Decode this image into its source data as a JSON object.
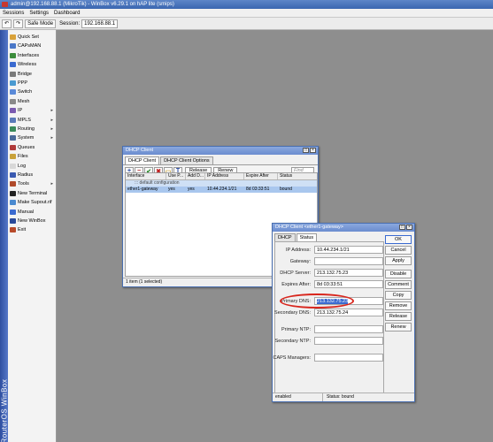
{
  "window": {
    "title": "admin@192.168.88.1 (MikroTik) - WinBox v6.29.1 on hAP lite (smips)"
  },
  "menu": [
    "Sessions",
    "Settings",
    "Dashboard"
  ],
  "toolbar": {
    "undo": "↶",
    "redo": "↷",
    "safe_mode": "Safe Mode",
    "session_label": "Session:",
    "session_value": "192.168.88.1"
  },
  "sidebar": {
    "brand": "RouterOS WinBox",
    "items": [
      {
        "label": "Quick Set",
        "icon": "quick-set-icon",
        "color": "#d9a23a",
        "arrow": ""
      },
      {
        "label": "CAPsMAN",
        "icon": "capsman-icon",
        "color": "#4a78c8",
        "arrow": ""
      },
      {
        "label": "Interfaces",
        "icon": "interfaces-icon",
        "color": "#3b8c3b",
        "arrow": ""
      },
      {
        "label": "Wireless",
        "icon": "wireless-icon",
        "color": "#3a6ad0",
        "arrow": ""
      },
      {
        "label": "Bridge",
        "icon": "bridge-icon",
        "color": "#7a7a7a",
        "arrow": ""
      },
      {
        "label": "PPP",
        "icon": "ppp-icon",
        "color": "#4a9ad0",
        "arrow": ""
      },
      {
        "label": "Switch",
        "icon": "switch-icon",
        "color": "#5a8ad8",
        "arrow": ""
      },
      {
        "label": "Mesh",
        "icon": "mesh-icon",
        "color": "#8a8a8a",
        "arrow": ""
      },
      {
        "label": "IP",
        "icon": "ip-icon",
        "color": "#7a5ab0",
        "arrow": "▸"
      },
      {
        "label": "MPLS",
        "icon": "mpls-icon",
        "color": "#5a7ab8",
        "arrow": "▸"
      },
      {
        "label": "Routing",
        "icon": "routing-icon",
        "color": "#3a8a5a",
        "arrow": "▸"
      },
      {
        "label": "System",
        "icon": "system-icon",
        "color": "#4a6a9a",
        "arrow": "▸"
      },
      {
        "label": "Queues",
        "icon": "queues-icon",
        "color": "#b03a3a",
        "arrow": ""
      },
      {
        "label": "Files",
        "icon": "files-icon",
        "color": "#c9a23a",
        "arrow": ""
      },
      {
        "label": "Log",
        "icon": "log-icon",
        "color": "#d8d8d8",
        "arrow": ""
      },
      {
        "label": "Radius",
        "icon": "radius-icon",
        "color": "#3a5ab0",
        "arrow": ""
      },
      {
        "label": "Tools",
        "icon": "tools-icon",
        "color": "#b04a2a",
        "arrow": "▸"
      },
      {
        "label": "New Terminal",
        "icon": "terminal-icon",
        "color": "#222222",
        "arrow": ""
      },
      {
        "label": "Make Supout.rif",
        "icon": "supout-icon",
        "color": "#4a8ad0",
        "arrow": ""
      },
      {
        "label": "Manual",
        "icon": "manual-icon",
        "color": "#3a6ad0",
        "arrow": ""
      },
      {
        "label": "New WinBox",
        "icon": "winbox-icon",
        "color": "#2a4a9a",
        "arrow": ""
      },
      {
        "label": "Exit",
        "icon": "exit-icon",
        "color": "#b84a2a",
        "arrow": ""
      }
    ]
  },
  "dhcp_client_window": {
    "title": "DHCP Client",
    "tabs": [
      "DHCP Client",
      "DHCP Client Options"
    ],
    "buttons": {
      "release": "Release",
      "renew": "Renew"
    },
    "find_placeholder": "Find",
    "columns": [
      "Interface",
      "Use P...",
      "Add D...",
      "IP Address",
      "Expire After",
      "Status"
    ],
    "comment_row": "::: default configuration",
    "rows": [
      [
        "ether1-gateway",
        "yes",
        "yes",
        "10.44.234.1/21",
        "8d 03:33:51",
        "bound"
      ]
    ],
    "status": "1 item (1 selected)"
  },
  "dhcp_client_detail": {
    "title": "DHCP Client <ether1-gateway>",
    "tabs": [
      "DHCP",
      "Status"
    ],
    "fields": [
      {
        "label": "IP Address:",
        "value": "10.44.234.1/21"
      },
      {
        "label": "Gateway:",
        "value": ""
      },
      {
        "label": "DHCP Server:",
        "value": "213.132.75.23"
      },
      {
        "label": "Expires After:",
        "value": "8d 03:33:51"
      },
      {
        "label": "Primary DNS:",
        "value": "213.132.75.23"
      },
      {
        "label": "Secondary DNS:",
        "value": "213.132.75.24"
      },
      {
        "label": "Primary NTP:",
        "value": ""
      },
      {
        "label": "Secondary NTP:",
        "value": ""
      },
      {
        "label": "CAPS Managers:",
        "value": ""
      }
    ],
    "buttons": [
      "OK",
      "Cancel",
      "Apply",
      "Disable",
      "Comment",
      "Copy",
      "Remove",
      "Release",
      "Renew"
    ],
    "status_left": "enabled",
    "status_right": "Status: bound"
  }
}
